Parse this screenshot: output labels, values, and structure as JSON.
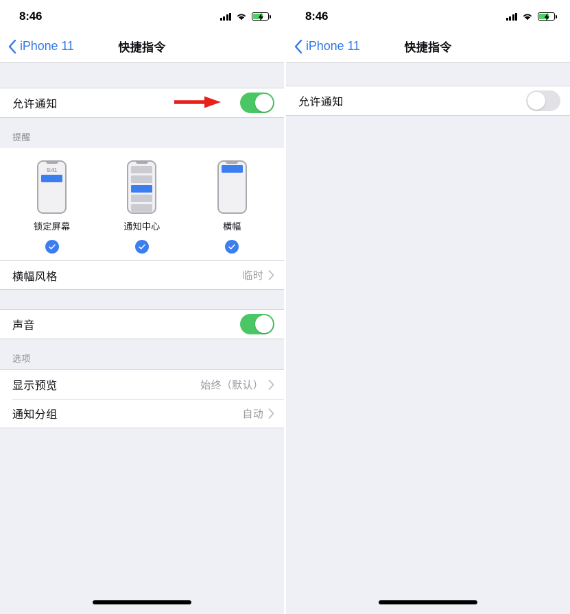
{
  "status_bar": {
    "time": "8:46",
    "signal_icon": "cellular-signal-icon",
    "wifi_icon": "wifi-icon",
    "battery_icon": "battery-charging-icon"
  },
  "nav": {
    "back_label": "iPhone 11",
    "back_icon": "chevron-left-icon",
    "title": "快捷指令"
  },
  "left_panel": {
    "allow_notifications": {
      "label": "允许通知",
      "toggle_state": "on"
    },
    "annotation": {
      "type": "red-arrow",
      "color": "#e8201c",
      "points_to": "allow-notifications-toggle"
    },
    "alerts_section": {
      "header": "提醒",
      "options": [
        {
          "label": "锁定屏幕",
          "preview": "lock-screen",
          "time": "9:41",
          "checked": true
        },
        {
          "label": "通知中心",
          "preview": "notification-center",
          "checked": true
        },
        {
          "label": "横幅",
          "preview": "banner",
          "checked": true
        }
      ],
      "banner_style": {
        "label": "横幅风格",
        "value": "临时"
      }
    },
    "sound_section": {
      "label": "声音",
      "toggle_state": "on"
    },
    "options_section": {
      "header": "选项",
      "rows": [
        {
          "label": "显示预览",
          "value": "始终（默认）"
        },
        {
          "label": "通知分组",
          "value": "自动"
        }
      ]
    }
  },
  "right_panel": {
    "allow_notifications": {
      "label": "允许通知",
      "toggle_state": "off"
    }
  },
  "colors": {
    "ios_blue": "#3378e8",
    "toggle_green": "#4ac764",
    "check_blue": "#3b7ef0",
    "annotation_red": "#e8201c",
    "page_background": "#eff0f5"
  }
}
